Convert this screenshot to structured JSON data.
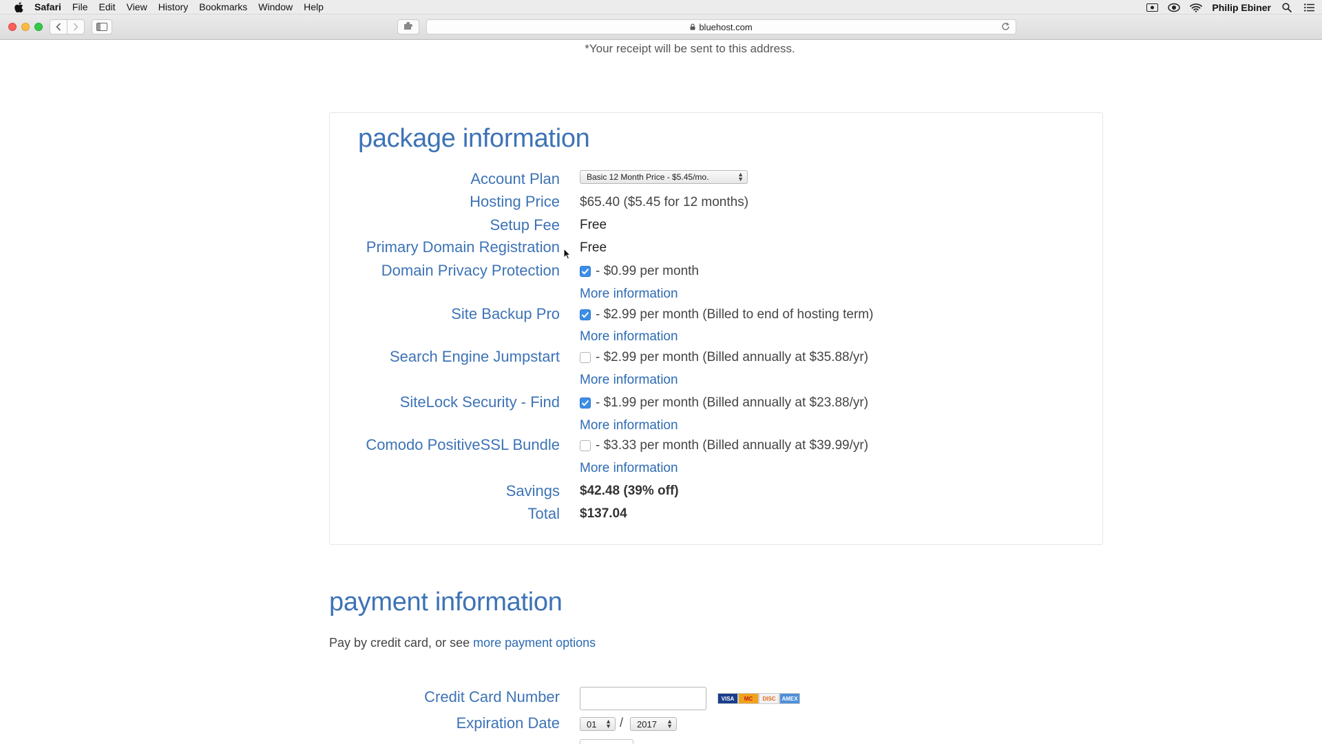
{
  "menubar": {
    "app": "Safari",
    "items": [
      "File",
      "Edit",
      "View",
      "History",
      "Bookmarks",
      "Window",
      "Help"
    ],
    "user": "Philip Ebiner"
  },
  "browser": {
    "address": "bluehost.com"
  },
  "page": {
    "receipt_note": "*Your receipt will be sent to this address.",
    "package": {
      "title": "package information",
      "rows": {
        "account_plan": {
          "label": "Account Plan",
          "value": "Basic 12 Month Price - $5.45/mo."
        },
        "hosting_price": {
          "label": "Hosting Price",
          "value": "$65.40  ($5.45 for 12 months)"
        },
        "setup_fee": {
          "label": "Setup Fee",
          "value": "Free"
        },
        "domain_registration": {
          "label": "Primary Domain Registration",
          "value": "Free"
        },
        "privacy": {
          "label": "Domain Privacy Protection",
          "value": "- $0.99 per month",
          "checked": true,
          "link": "More information"
        },
        "backup": {
          "label": "Site Backup Pro",
          "value": "- $2.99 per month (Billed to end of hosting term)",
          "checked": true,
          "link": "More information"
        },
        "jumpstart": {
          "label": "Search Engine Jumpstart",
          "value": "- $2.99 per month (Billed annually at $35.88/yr)",
          "checked": false,
          "link": "More information"
        },
        "sitelock": {
          "label": "SiteLock Security - Find",
          "value": "- $1.99 per month (Billed annually at $23.88/yr)",
          "checked": true,
          "link": "More information"
        },
        "ssl": {
          "label": "Comodo PositiveSSL Bundle",
          "value": "- $3.33 per month (Billed annually at $39.99/yr)",
          "checked": false,
          "link": "More information"
        },
        "savings": {
          "label": "Savings",
          "value": "$42.48 (39% off)"
        },
        "total": {
          "label": "Total",
          "value": "$137.04"
        }
      }
    },
    "payment": {
      "title": "payment information",
      "note_prefix": "Pay by credit card, or see ",
      "note_link": "more payment options",
      "cc_label": "Credit Card Number",
      "cc_value": "",
      "card_brands": [
        "VISA",
        "MC",
        "DISC",
        "AMEX"
      ],
      "exp_label": "Expiration Date",
      "exp_month": "01",
      "exp_year": "2017",
      "exp_separator": "/"
    }
  },
  "colors": {
    "accent": "#3d73b6",
    "link": "#2d6bb3",
    "checkbox": "#3d8ee8"
  }
}
